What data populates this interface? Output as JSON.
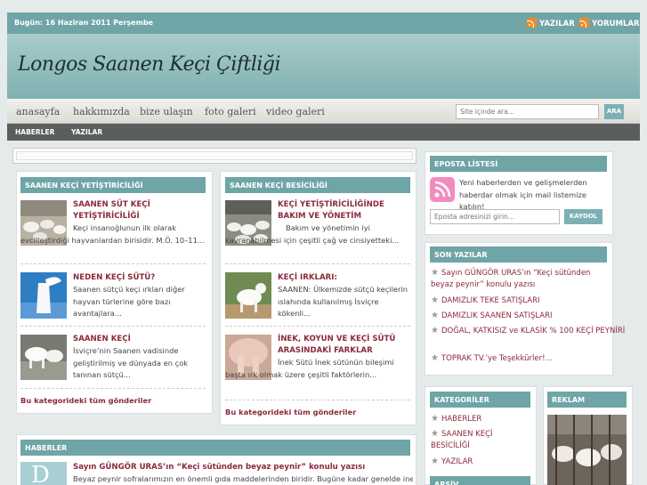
{
  "header": {
    "date": "Bugün: 16 Haziran 2011 Perşembe",
    "rss_posts": "YAZILAR",
    "rss_comments": "YORUMLAR",
    "site_title": "Longos Saanen Keçi Çiftliği"
  },
  "nav": {
    "items": [
      "anasayfa",
      "hakkımızda",
      "bize ulaşın",
      "foto galeri",
      "video galeri"
    ],
    "search_placeholder": "Site içinde ara...",
    "search_button": "ARA"
  },
  "subnav": {
    "items": [
      "HABERLER",
      "YAZILAR"
    ]
  },
  "cat1": {
    "title": "SAANEN KEÇİ YETİŞTİRİCİLİĞİ",
    "posts": [
      {
        "title": "SAANEN SÜT KEÇİ YETİŞTİRİCİLİĞİ",
        "text": "Keçi insanoğlunun ilk olarak evcilleştirdiği hayvanlardan birisidir. M.Ö. 10–11..."
      },
      {
        "title": "NEDEN KEÇİ SÜTÜ?",
        "text": "Saanen sütçü keçi ırkları diğer hayvan türlerine göre bazı avantajlara..."
      },
      {
        "title": "SAANEN KEÇİ",
        "text": "İsviçre’nin Saanen vadisinde geliştirilmiş ve dünyada en çok tanınan sütçü..."
      }
    ],
    "more": "Bu kategorideki tüm gönderiler"
  },
  "cat2": {
    "title": "SAANEN KEÇİ BESİCİLİĞİ",
    "posts": [
      {
        "title": "KEÇİ YETİŞTİRİCİLİĞİNDE BAKIM VE YÖNETİM",
        "text": "Bakım ve yönetimin iyi kavranabilmesi için çeşitli çağ ve cinsiyetteki..."
      },
      {
        "title": "KEÇİ IRKLARI:",
        "text": "SAANEN: Ülkemizde sütçü keçilerin ıslahında kullanılmış İsviçre kökenli..."
      },
      {
        "title": "İNEK, KOYUN VE KEÇİ SÜTÜ ARASINDAKİ FARKLAR",
        "text": "İnek Sütü İnek sütünün bileşimi başta ırk olmak üzere çeşitli faktörlerin..."
      }
    ],
    "more": "Bu kategorideki tüm gönderiler"
  },
  "news": {
    "title": "HABERLER",
    "post_title": "Sayın GÜNGÖR URAS’ın “Keçi sütünden beyaz peynir” konulu yazısı",
    "post_text": "Beyaz peynir sofralarımızın en önemli gıda maddelerinden biridir. Bugüne kadar genelde inek",
    "thumb_letter": "D"
  },
  "sidebar": {
    "email": {
      "title": "EPOSTA LİSTESİ",
      "text": "Yeni haberlerden ve gelişmelerden haberdar olmak için mail listemize katılın!",
      "placeholder": "Eposta adresinizi girin...",
      "button": "KAYDOL"
    },
    "recent": {
      "title": "SON YAZILAR",
      "items": [
        "Sayın GÜNGÖR URAS’ın “Keçi sütünden beyaz peynir” konulu yazısı",
        "DAMIZLIK TEKE SATIŞLARI",
        "DAMIZLIK SAANEN SATIŞLARI",
        "DOĞAL, KATKISIZ ve KLASİK % 100 KEÇİ PEYNİRİ",
        "TOPRAK TV.’ye Teşekkürler!..."
      ]
    },
    "categories": {
      "title": "KATEGORİLER",
      "items": [
        "HABERLER",
        "SAANEN KEÇİ BESİCİLİĞİ",
        "YAZILAR"
      ]
    },
    "archive": {
      "title": "ARŞİV"
    },
    "ad": {
      "title": "REKLAM"
    }
  },
  "colors": {
    "accent": "#6fa5a6",
    "link": "#8b2a3b",
    "subnav": "#5b5e5f"
  }
}
